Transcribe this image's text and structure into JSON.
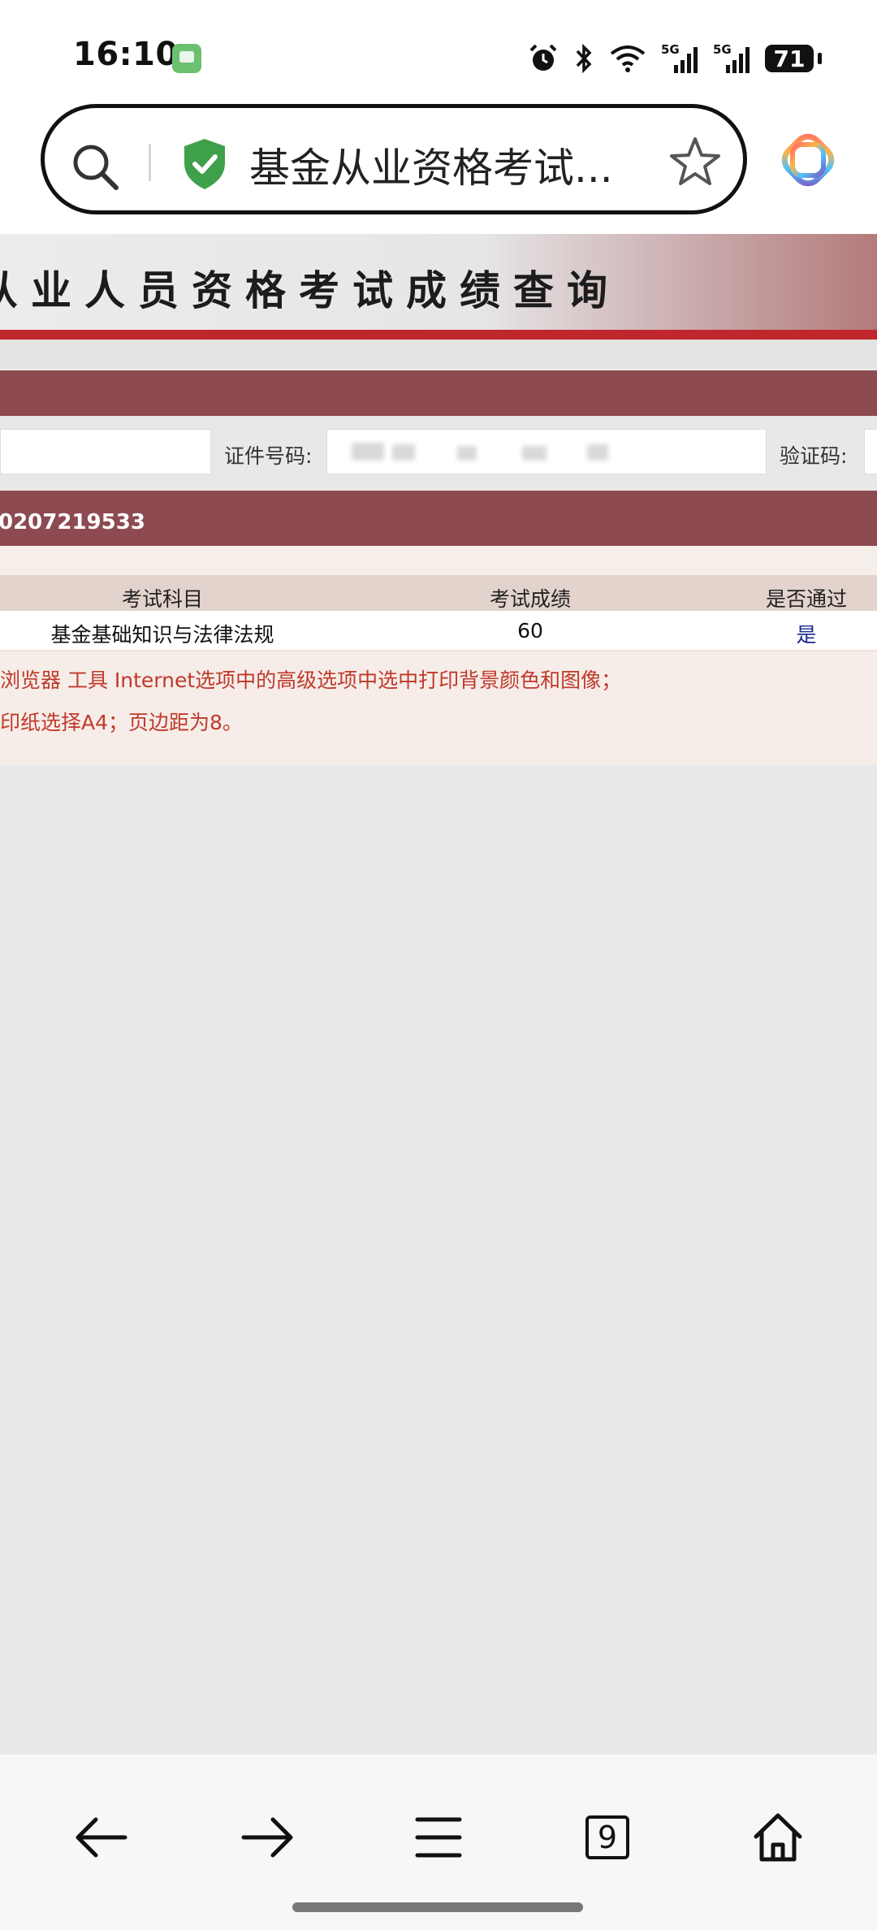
{
  "status_bar": {
    "time": "16:10",
    "signal_labels": [
      "5G",
      "5G"
    ],
    "battery": "71",
    "icons": [
      "message-app-icon",
      "alarm-icon",
      "bluetooth-icon",
      "wifi-icon",
      "cellular-signal-icon",
      "battery-icon"
    ]
  },
  "browser": {
    "url_title": "基金从业资格考试...",
    "icons": [
      "search-icon",
      "security-shield-icon",
      "bookmark-star-icon",
      "ai-assistant-icon"
    ]
  },
  "page": {
    "banner_title": "从业人员资格考试成绩查询",
    "form": {
      "id_label": "证件号码:",
      "captcha_label": "验证码:"
    },
    "registration_number": "0207219533",
    "table": {
      "headers": [
        "考试科目",
        "考试成绩",
        "是否通过"
      ],
      "rows": [
        {
          "subject": "基金基础知识与法律法规",
          "score": "60",
          "passed": "是"
        }
      ]
    },
    "notes": [
      "浏览器 工具 Internet选项中的高级选项中选中打印背景颜色和图像；",
      "印纸选择A4；页边距为8。"
    ]
  },
  "bottom_nav": {
    "tab_count": "9",
    "icons": [
      "back-arrow-icon",
      "forward-arrow-icon",
      "menu-icon",
      "tabs-icon",
      "home-icon"
    ]
  },
  "colors": {
    "accent_dark_red": "#8d4a50",
    "banner_red_line": "#c0272d",
    "note_text_red": "#c0392b",
    "shield_green": "#3fa04b",
    "pass_text_blue": "#1a2a8c"
  }
}
